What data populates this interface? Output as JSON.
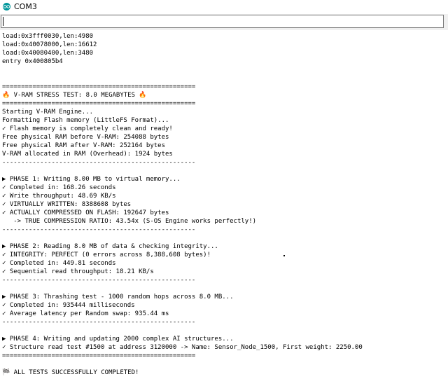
{
  "window": {
    "title": "COM3",
    "icon": "arduino-logo-icon"
  },
  "send_field": {
    "value": ""
  },
  "serial_output": [
    "load:0x3fff0030,len:4980",
    "load:0x40078000,len:16612",
    "load:0x40080400,len:3480",
    "entry 0x400805b4",
    "",
    "",
    "===================================================",
    "🔥 V-RAM STRESS TEST: 8.0 MEGABYTES 🔥",
    "===================================================",
    "Starting V-RAM Engine...",
    "Formatting Flash memory (LittleFS Format)...",
    "✓ Flash memory is completely clean and ready!",
    "Free physical RAM before V-RAM: 254088 bytes",
    "Free physical RAM after V-RAM: 252164 bytes",
    "V-RAM allocated in RAM (Overhead): 1924 bytes",
    "---------------------------------------------------",
    "",
    "▶ PHASE 1: Writing 8.00 MB to virtual memory...",
    "✓ Completed in: 168.26 seconds",
    "✓ Write throughput: 48.69 KB/s",
    "✓ VIRTUALLY WRITTEN: 8388608 bytes",
    "✓ ACTUALLY COMPRESSED ON FLASH: 192647 bytes",
    "   -> TRUE COMPRESSION RATIO: 43.54x (S-OS Engine works perfectly!)",
    "---------------------------------------------------",
    "",
    "▶ PHASE 2: Reading 8.0 MB of data & checking integrity...",
    "✓ INTEGRITY: PERFECT (0 errors across 8,388,608 bytes)!",
    "✓ Completed in: 449.81 seconds",
    "✓ Sequential read throughput: 18.21 KB/s",
    "---------------------------------------------------",
    "",
    "▶ PHASE 3: Thrashing test - 1000 random hops across 8.0 MB...",
    "✓ Completed in: 935444 milliseconds",
    "✓ Average latency per Random swap: 935.44 ms",
    "---------------------------------------------------",
    "",
    "▶ PHASE 4: Writing and updating 2000 complex AI structures...",
    "✓ Structure read test #1500 at address 3120000 -> Name: Sensor_Node_1500, First weight: 2250.00",
    "===================================================",
    "",
    "🏁 ALL TESTS SUCCESSFULLY COMPLETED!"
  ]
}
